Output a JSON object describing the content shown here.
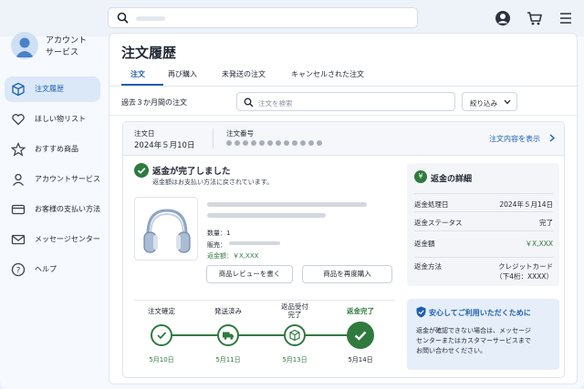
{
  "sidebar": {
    "account_name_line1": "アカウント",
    "account_name_line2": "サービス",
    "items": [
      {
        "label": "注文履歴",
        "icon": "package-icon",
        "active": true
      },
      {
        "label": "ほしい物リスト",
        "icon": "heart-icon"
      },
      {
        "label": "おすすめ商品",
        "icon": "star-icon"
      },
      {
        "label": "アカウントサービス",
        "icon": "person-icon"
      },
      {
        "label": "お客様の支払い方法",
        "icon": "credit-card-icon"
      },
      {
        "label": "メッセージセンター",
        "icon": "mail-icon"
      },
      {
        "label": "ヘルプ",
        "icon": "help-icon"
      }
    ]
  },
  "header": {
    "icons": [
      "search-icon",
      "account-icon",
      "cart-icon",
      "menu-icon"
    ]
  },
  "main": {
    "title": "注文履歴",
    "tabs": [
      "注文",
      "再び購入",
      "未発送の注文",
      "キャンセルされた注文"
    ],
    "filter_label": "過去３か月間の注文",
    "search_placeholder": "注文を検索",
    "narrow_label": "絞り込み"
  },
  "order": {
    "date_label": "注文日",
    "date_value": "2024年５月10日",
    "number_label": "注文番号",
    "view_link": "注文内容を表示",
    "refund_title": "返金が完了しました",
    "refund_sub": "返金額はお支払い方法に戻されています。",
    "qty": "数量：1",
    "seller": "販売：",
    "refund_amount": "返金額：￥X,XXX",
    "review_button": "商品レビューを書く",
    "rebuy_button": "商品を再度購入",
    "steps": [
      {
        "label": "注文確定",
        "date": "5月10日",
        "icon": "check-icon"
      },
      {
        "label": "発送済み",
        "date": "5月11日",
        "icon": "truck-icon"
      },
      {
        "label": "返品受付\n完了",
        "date": "5月13日",
        "icon": "box-icon"
      },
      {
        "label": "返金完了",
        "date": "5月14日",
        "icon": "check-icon"
      }
    ]
  },
  "refund_details": {
    "title": "返金の詳細",
    "rows": [
      {
        "k": "返金処理日",
        "v": "2024年５月14日"
      },
      {
        "k": "返金ステータス",
        "v": "完了"
      },
      {
        "k": "返金額",
        "v": "￥X,XXX"
      },
      {
        "k": "返金方法",
        "v": "クレジットカード",
        "v2": "（下4桁：XXXX）"
      }
    ]
  },
  "safe": {
    "title": "安心してご利用いただくために",
    "body_line1": "返金が確認できない場合は、メッセージ",
    "body_line2": "センターまたはカスタマーサービスまで",
    "body_line3": "お問い合わせください。"
  },
  "colors": {
    "accent": "#1c5fb0",
    "success": "#2f7a3f"
  }
}
